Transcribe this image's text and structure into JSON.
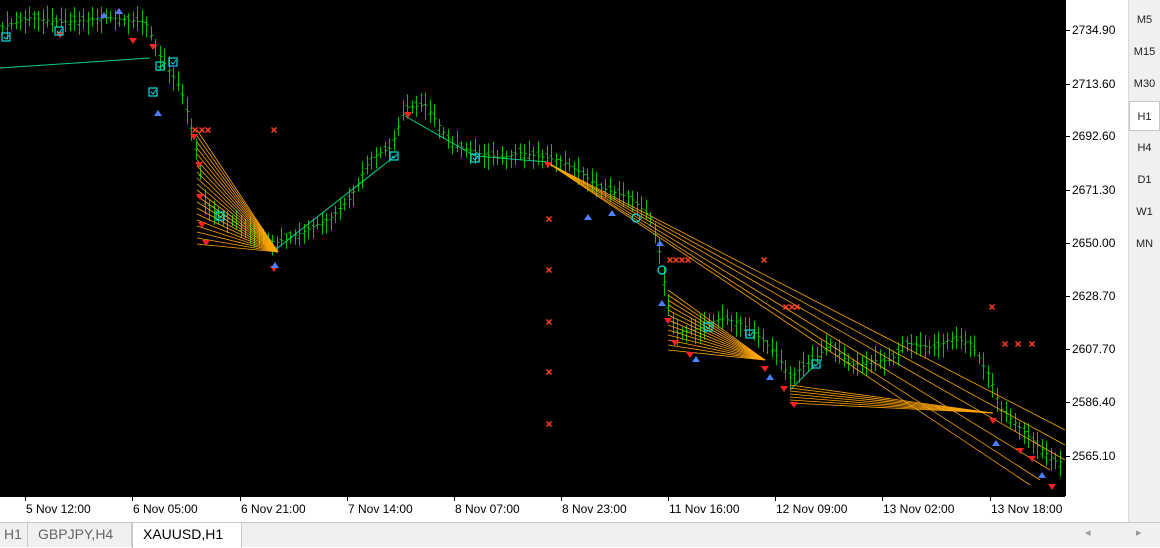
{
  "window": {
    "symbol": "XAUUSD",
    "timeframe": "H1"
  },
  "timeframes": [
    {
      "label": "M5",
      "active": false
    },
    {
      "label": "M15",
      "active": false
    },
    {
      "label": "M30",
      "active": false
    },
    {
      "label": "H1",
      "active": true
    },
    {
      "label": "H4",
      "active": false
    },
    {
      "label": "D1",
      "active": false
    },
    {
      "label": "W1",
      "active": false
    },
    {
      "label": "MN",
      "active": false
    }
  ],
  "tabs": [
    {
      "label": "H1",
      "active": false
    },
    {
      "label": "GBPJPY,H4",
      "active": false
    },
    {
      "label": "XAUUSD,H1",
      "active": true
    }
  ],
  "scroll_arrows": {
    "left": "◂",
    "right": "▸"
  },
  "colors": {
    "background": "#000000",
    "bar": "#00c000",
    "fib_lines": "#ffa500",
    "signal_down": "#ff2020",
    "signal_up": "#4f7fff",
    "marker_box": "#00e0e0",
    "marker_cross": "#ff4020",
    "trend_line": "#00d080"
  },
  "chart_data": {
    "type": "ohlc",
    "price_axis": {
      "ticks": [
        2734.9,
        2713.6,
        2692.6,
        2671.3,
        2650.0,
        2628.7,
        2607.7,
        2586.4,
        2565.1
      ],
      "range": [
        2549.0,
        2747.0
      ]
    },
    "time_axis": {
      "labels": [
        "5 Nov 12:00",
        "6 Nov 05:00",
        "6 Nov 21:00",
        "7 Nov 14:00",
        "8 Nov 07:00",
        "8 Nov 23:00",
        "11 Nov 16:00",
        "12 Nov 09:00",
        "13 Nov 02:00",
        "13 Nov 18:00"
      ]
    },
    "series": [
      {
        "path": [
          [
            0,
            2736
          ],
          [
            30,
            2740
          ],
          [
            60,
            2738
          ],
          [
            110,
            2740
          ],
          [
            145,
            2738
          ],
          [
            160,
            2724
          ],
          [
            180,
            2712
          ],
          [
            195,
            2690
          ],
          [
            205,
            2665
          ],
          [
            225,
            2660
          ],
          [
            250,
            2655
          ],
          [
            275,
            2650
          ],
          [
            300,
            2654
          ],
          [
            330,
            2660
          ],
          [
            350,
            2668
          ],
          [
            370,
            2684
          ],
          [
            390,
            2688
          ],
          [
            405,
            2704
          ],
          [
            425,
            2705
          ],
          [
            450,
            2690
          ],
          [
            475,
            2686
          ],
          [
            500,
            2684
          ],
          [
            520,
            2686
          ],
          [
            545,
            2684
          ],
          [
            560,
            2683
          ],
          [
            580,
            2678
          ],
          [
            600,
            2672
          ],
          [
            630,
            2668
          ],
          [
            650,
            2660
          ],
          [
            660,
            2645
          ],
          [
            665,
            2630
          ],
          [
            675,
            2614
          ],
          [
            700,
            2616
          ],
          [
            720,
            2620
          ],
          [
            740,
            2618
          ],
          [
            760,
            2612
          ],
          [
            775,
            2606
          ],
          [
            790,
            2596
          ],
          [
            800,
            2600
          ],
          [
            815,
            2604
          ],
          [
            830,
            2610
          ],
          [
            850,
            2601
          ],
          [
            870,
            2603
          ],
          [
            890,
            2603
          ],
          [
            905,
            2610
          ],
          [
            935,
            2608
          ],
          [
            950,
            2612
          ],
          [
            970,
            2610
          ],
          [
            990,
            2596
          ],
          [
            1000,
            2584
          ],
          [
            1020,
            2576
          ],
          [
            1040,
            2568
          ],
          [
            1055,
            2563
          ],
          [
            1065,
            2562
          ]
        ]
      }
    ]
  }
}
